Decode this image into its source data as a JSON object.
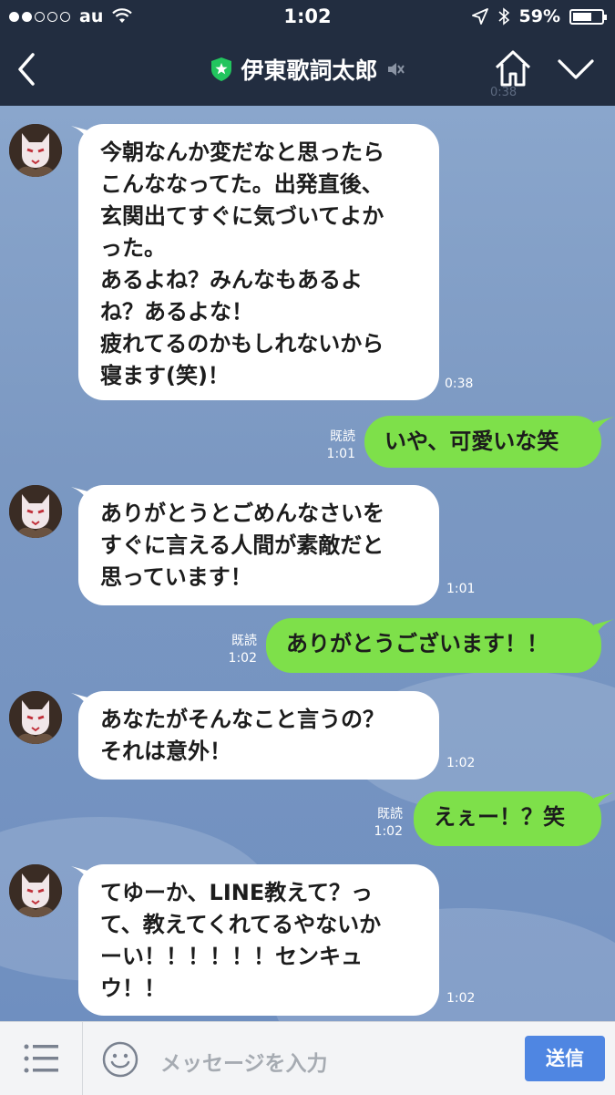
{
  "status_bar": {
    "carrier": "au",
    "time": "1:02",
    "battery": "59%",
    "signal_bars_filled": 2,
    "signal_bars_total": 5,
    "battery_level": 0.59
  },
  "header": {
    "title": "伊東歌詞太郎",
    "background_time": "0:38"
  },
  "messages": [
    {
      "side": "in",
      "text": "今朝なんか変だなと思ったら\nこんななってた。出発直後、\n玄関出てすぐに気づいてよか\nった。\nあるよね？みんなもあるよ\nね？あるよな！\n疲れてるのかもしれないから\n寝ます(笑)！",
      "time": "0:38"
    },
    {
      "side": "out",
      "text": "いや、可愛いな笑",
      "read": "既読",
      "time": "1:01"
    },
    {
      "side": "in",
      "text": "ありがとうとごめんなさいを\nすぐに言える人間が素敵だと\n思っています！",
      "time": "1:01"
    },
    {
      "side": "out",
      "text": "ありがとうございます！！",
      "read": "既読",
      "time": "1:02"
    },
    {
      "side": "in",
      "text": "あなたがそんなこと言うの？\nそれは意外！",
      "time": "1:02"
    },
    {
      "side": "out",
      "text": "えぇー！？笑",
      "read": "既読",
      "time": "1:02"
    },
    {
      "side": "in",
      "text": "てゆーか、LINE教えて？っ\nて、教えてくれてるやないか\nーい！！！！！！センキュ\nウ！！",
      "time": "1:02"
    }
  ],
  "input": {
    "placeholder": "メッセージを入力",
    "send_label": "送信"
  },
  "colors": {
    "header_bg": "#222d40",
    "bubble_out": "#7ee04a",
    "bubble_in": "#ffffff",
    "send_button": "#4f86e2",
    "chat_bg": "#7f9cc4"
  },
  "icons": [
    "back-icon",
    "official-badge-icon",
    "mute-icon",
    "home-icon",
    "chevron-down-icon",
    "menu-icon",
    "smile-icon",
    "wifi-icon",
    "location-icon",
    "bluetooth-icon"
  ]
}
